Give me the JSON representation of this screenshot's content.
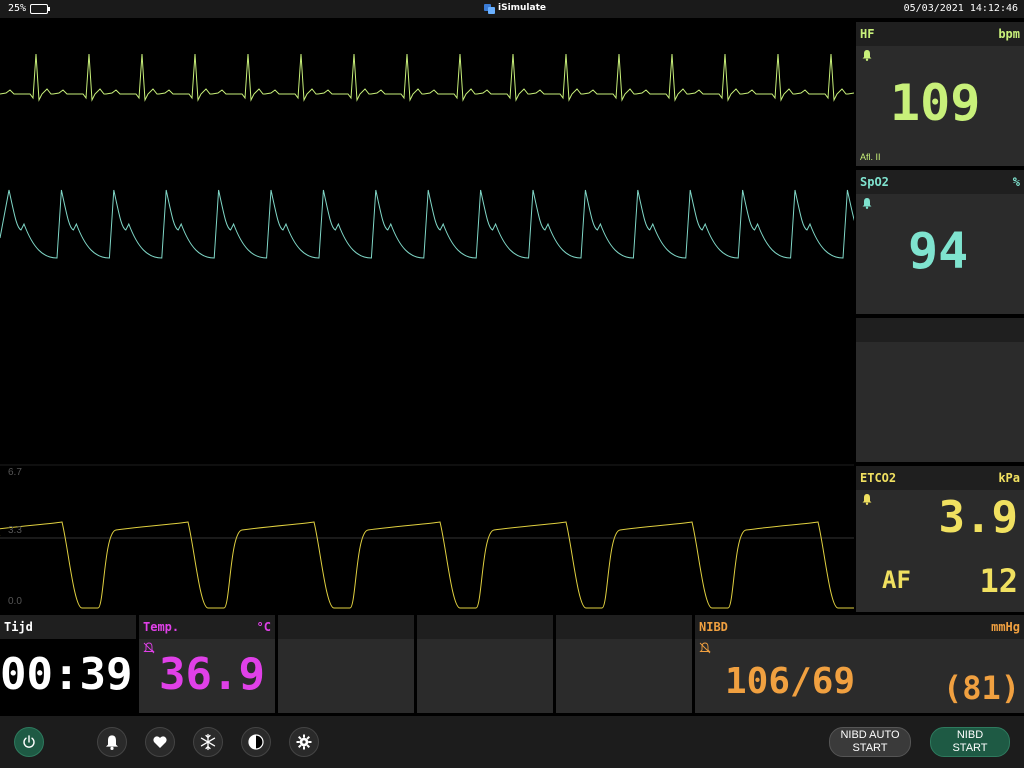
{
  "status": {
    "battery_percent": "25%",
    "app_name": "iSimulate",
    "datetime": "05/03/2021 14:12:46"
  },
  "waves": {
    "ecg_color": "#c8f07a",
    "pleth_color": "#7fd6c6",
    "co2_color": "#e0d040",
    "co2_scale_max": "6.7",
    "co2_scale_mid": "3.3",
    "co2_scale_min": "0.0"
  },
  "hf": {
    "label": "HF",
    "unit": "bpm",
    "value": "109",
    "lead": "Afl. II",
    "color": "#c8f07a",
    "alarm_icon": "bell-icon"
  },
  "spo2": {
    "label": "SpO2",
    "unit": "%",
    "value": "94",
    "color": "#7fe3cf",
    "alarm_icon": "bell-icon"
  },
  "etco2": {
    "label": "ETCO2",
    "unit": "kPa",
    "value": "3.9",
    "af_label": "AF",
    "af_value": "12",
    "color": "#f0e060",
    "alarm_icon": "bell-icon"
  },
  "timer": {
    "label": "Tijd",
    "value": "00:39"
  },
  "temp": {
    "label": "Temp.",
    "unit": "°C",
    "value": "36.9",
    "color": "#e040e8",
    "alarm_icon": "bell-off-icon"
  },
  "nibd": {
    "label": "NIBD",
    "unit": "mmHg",
    "value": "106/69",
    "mean": "(81)",
    "color": "#f0a040",
    "alarm_icon": "bell-off-icon"
  },
  "toolbar": {
    "power_icon": "power-icon",
    "alarm_icon": "bell-icon",
    "heart_icon": "heart-icon",
    "freeze_icon": "snowflake-icon",
    "contrast_icon": "contrast-icon",
    "settings_icon": "gear-icon",
    "nibd_auto_line1": "NIBD AUTO",
    "nibd_auto_line2": "START",
    "nibd_line1": "NIBD",
    "nibd_line2": "START"
  }
}
